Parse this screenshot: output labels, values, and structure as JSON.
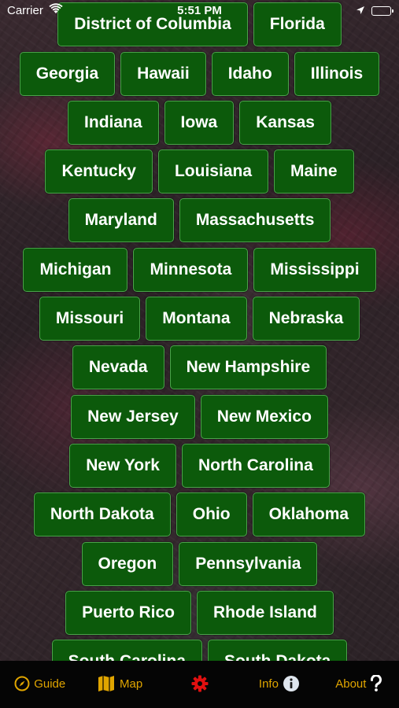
{
  "status_bar": {
    "carrier": "Carrier",
    "time": "5:51 PM"
  },
  "states": [
    [
      "District of Columbia",
      "Florida"
    ],
    [
      "Georgia",
      "Hawaii",
      "Idaho",
      "Illinois"
    ],
    [
      "Indiana",
      "Iowa",
      "Kansas"
    ],
    [
      "Kentucky",
      "Louisiana",
      "Maine"
    ],
    [
      "Maryland",
      "Massachusetts"
    ],
    [
      "Michigan",
      "Minnesota",
      "Mississippi"
    ],
    [
      "Missouri",
      "Montana",
      "Nebraska"
    ],
    [
      "Nevada",
      "New Hampshire"
    ],
    [
      "New Jersey",
      "New Mexico"
    ],
    [
      "New York",
      "North Carolina"
    ],
    [
      "North Dakota",
      "Ohio",
      "Oklahoma"
    ],
    [
      "Oregon",
      "Pennsylvania"
    ],
    [
      "Puerto Rico",
      "Rhode Island"
    ],
    [
      "South Carolina",
      "South Dakota"
    ]
  ],
  "tab_bar": {
    "items": [
      {
        "label": "Guide",
        "icon": "compass-icon"
      },
      {
        "label": "Map",
        "icon": "map-icon"
      },
      {
        "label": "",
        "icon": "gear-icon"
      },
      {
        "label": "Info",
        "icon": "info-icon"
      },
      {
        "label": "About",
        "icon": "question-icon"
      }
    ]
  },
  "colors": {
    "button_bg": "#0c5a0b",
    "button_border": "#4aa34a",
    "tab_accent": "#e0a500",
    "gear_red": "#e01010",
    "tabbar_bg": "#050505"
  }
}
